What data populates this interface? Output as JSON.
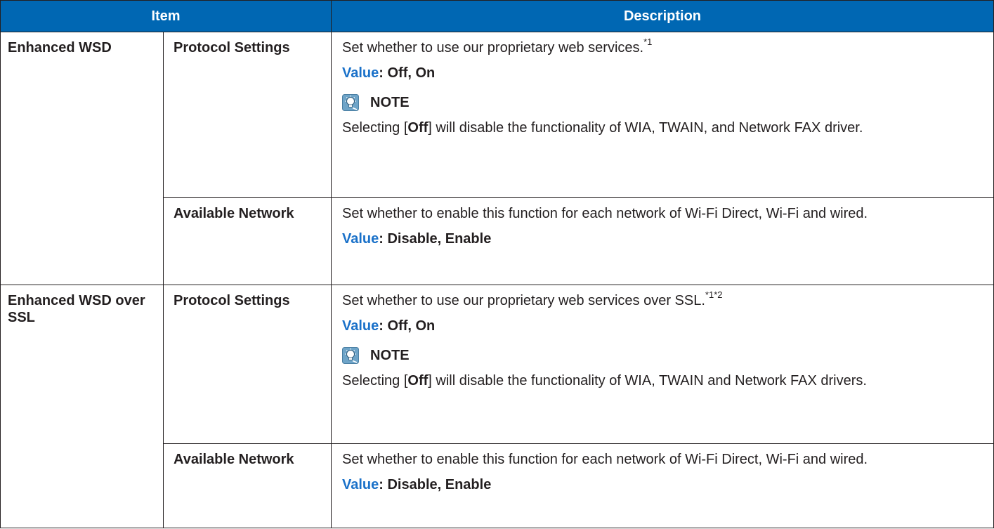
{
  "header": {
    "item": "Item",
    "description": "Description"
  },
  "groups": [
    {
      "name": "Enhanced WSD",
      "rows": [
        {
          "setting": "Protocol Settings",
          "desc": "Set whether to use our proprietary web services.",
          "sup": "*1",
          "value_label": "Value",
          "value": ": Off, On",
          "note_title": "NOTE",
          "note_pre": "Selecting [",
          "note_bold": "Off",
          "note_post": "] will disable the functionality of WIA, TWAIN, and Network FAX driver."
        },
        {
          "setting": "Available Network",
          "desc": "Set whether to enable this function for each network of Wi-Fi Direct, Wi-Fi and wired.",
          "value_label": "Value",
          "value": ": Disable, Enable"
        }
      ]
    },
    {
      "name": "Enhanced WSD over SSL",
      "rows": [
        {
          "setting": "Protocol Settings",
          "desc": "Set whether to use our proprietary web services over SSL.",
          "sup": "*1*2",
          "value_label": "Value",
          "value": ": Off, On",
          "note_title": "NOTE",
          "note_pre": "Selecting [",
          "note_bold": "Off",
          "note_post": "] will disable the functionality of WIA, TWAIN and Network FAX drivers."
        },
        {
          "setting": "Available Network",
          "desc": "Set whether to enable this function for each network of Wi-Fi Direct, Wi-Fi and wired.",
          "value_label": "Value",
          "value": ": Disable, Enable"
        }
      ]
    }
  ],
  "icons": {
    "note": "lightbulb-note-icon"
  },
  "colors": {
    "header_bg": "#0067b3",
    "value_label": "#1a71c9",
    "text": "#231f20"
  }
}
